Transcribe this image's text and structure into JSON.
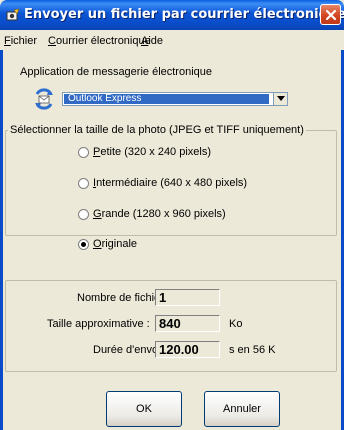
{
  "window": {
    "title": "Envoyer un fichier par courrier électronique"
  },
  "menu": {
    "items": [
      {
        "label": "Fichier",
        "accel": "F",
        "rest": "ichier"
      },
      {
        "label": "Courrier électronique",
        "accel": "C",
        "rest": "ourrier électronique"
      },
      {
        "label": "Aide",
        "accel": "A",
        "rest": "ide"
      }
    ]
  },
  "mail_app": {
    "label": "Application de messagerie électronique",
    "selected": "Outlook Express"
  },
  "photo_size": {
    "caption": "Sélectionner la taille de la photo (JPEG et TIFF uniquement)",
    "options": [
      {
        "label": "Petite (320 x 240 pixels)",
        "accel": "P",
        "rest": "etite (320 x 240 pixels)",
        "checked": false
      },
      {
        "label": "Intermédiaire (640 x 480 pixels)",
        "accel": "I",
        "rest": "ntermédiaire (640 x 480 pixels)",
        "checked": false
      },
      {
        "label": "Grande (1280 x 960 pixels)",
        "accel": "G",
        "rest": "rande (1280 x 960 pixels)",
        "checked": false
      },
      {
        "label": "Originale",
        "accel": "O",
        "rest": "riginale",
        "checked": true
      }
    ]
  },
  "info": {
    "file_count_label": "Nombre de fichiers :",
    "file_count": "1",
    "approx_size_label": "Taille approximative :",
    "approx_size": "840",
    "approx_size_unit": "Ko",
    "send_time_label": "Durée d'envoi :",
    "send_time": "120.00",
    "send_time_unit": "s en 56 K"
  },
  "buttons": {
    "ok": "OK",
    "cancel": "Annuler"
  },
  "colors": {
    "titlebar": "#0A4CC8",
    "selection": "#316AC5",
    "face": "#ECE9D8"
  }
}
